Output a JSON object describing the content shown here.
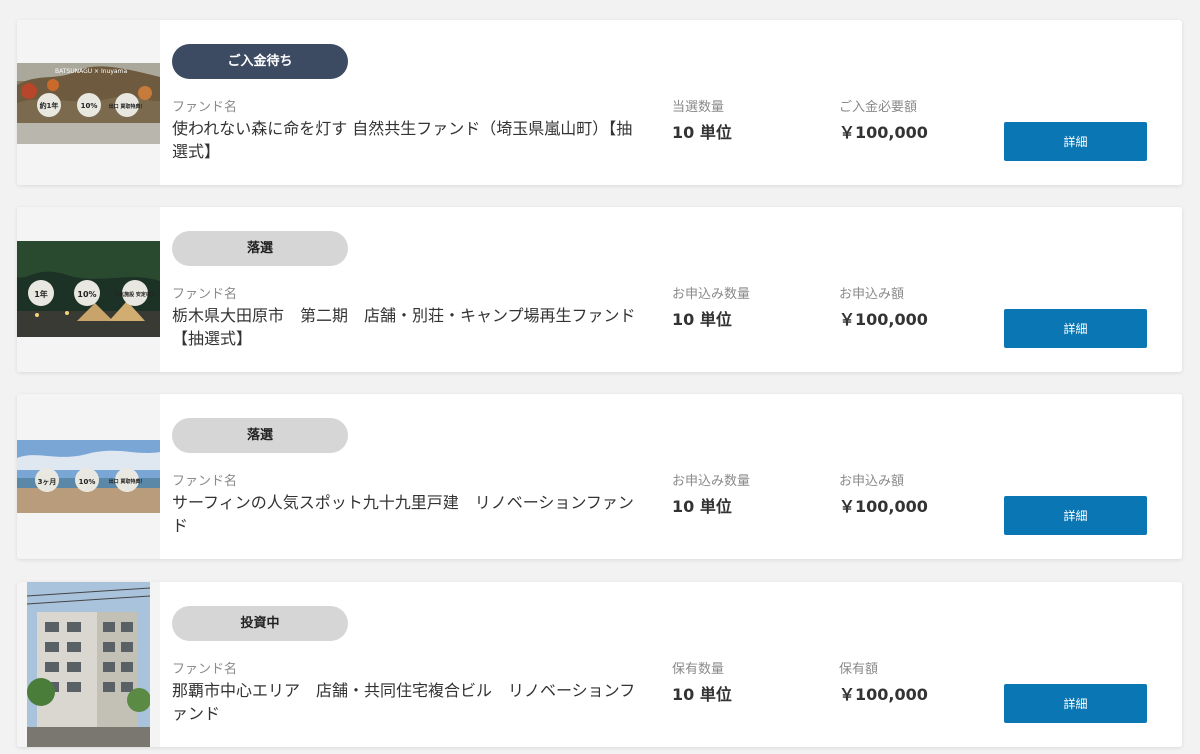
{
  "funds": [
    {
      "status": "ご入金待ち",
      "name_label": "ファンド名",
      "name": "使われない森に命を灯す 自然共生ファンド（埼玉県嵐山町）【抽選式】",
      "qty_label": "当選数量",
      "qty": "10 単位",
      "amount_label": "ご入金必要額",
      "amount": "￥100,000",
      "button": "詳細",
      "thumb_caption": "BATSUNAGU × Inuyama",
      "thumb_bubbles": [
        "約1年",
        "10%",
        "出口 買取特典！"
      ]
    },
    {
      "status": "落選",
      "name_label": "ファンド名",
      "name": "栃木県大田原市　第二期　店舗・別荘・キャンプ場再生ファンド【抽選式】",
      "qty_label": "お申込み数量",
      "qty": "10 単位",
      "amount_label": "お申込み額",
      "amount": "￥100,000",
      "button": "詳細",
      "thumb_bubbles": [
        "1年",
        "10%",
        "人気施設 安定収入"
      ]
    },
    {
      "status": "落選",
      "name_label": "ファンド名",
      "name": "サーフィンの人気スポット九十九里戸建　リノベーションファンド",
      "qty_label": "お申込み数量",
      "qty": "10 単位",
      "amount_label": "お申込み額",
      "amount": "￥100,000",
      "button": "詳細",
      "thumb_bubbles": [
        "3ヶ月",
        "10%",
        "出口 買取特典！"
      ]
    },
    {
      "status": "投資中",
      "name_label": "ファンド名",
      "name": "那覇市中心エリア　店舗・共同住宅複合ビル　リノベーションファンド",
      "qty_label": "保有数量",
      "qty": "10 単位",
      "amount_label": "保有額",
      "amount": "￥100,000",
      "button": "詳細"
    }
  ]
}
